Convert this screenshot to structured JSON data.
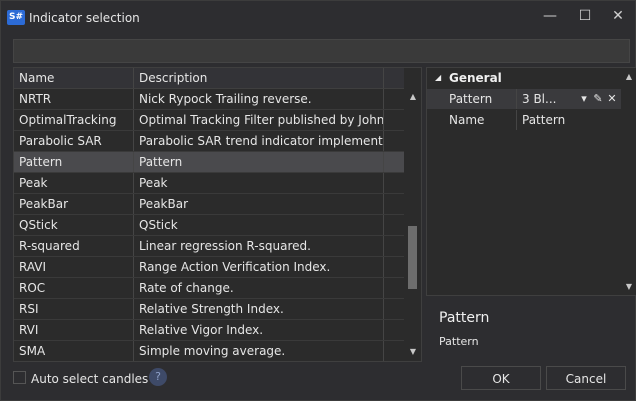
{
  "window": {
    "app_icon": "S#",
    "title": "Indicator selection",
    "controls": {
      "minimize": "—",
      "maximize": "☐",
      "close": "✕"
    }
  },
  "search": {
    "value": "",
    "placeholder": ""
  },
  "grid": {
    "columns": [
      "Name",
      "Description"
    ],
    "rows": [
      [
        "NRTR",
        "Nick Rypock Trailing reverse."
      ],
      [
        "OptimalTracking",
        "Optimal Tracking Filter published by John E..."
      ],
      [
        "Parabolic SAR",
        "Parabolic SAR trend indicator implementati..."
      ],
      [
        "Pattern",
        "Pattern"
      ],
      [
        "Peak",
        "Peak"
      ],
      [
        "PeakBar",
        "PeakBar"
      ],
      [
        "QStick",
        "QStick"
      ],
      [
        "R-squared",
        "Linear regression R-squared."
      ],
      [
        "RAVI",
        "Range Action Verification Index."
      ],
      [
        "ROC",
        "Rate of change."
      ],
      [
        "RSI",
        "Relative Strength Index."
      ],
      [
        "RVI",
        "Relative Vigor Index."
      ],
      [
        "SMA",
        "Simple moving average."
      ]
    ],
    "selected_index": 3
  },
  "properties": {
    "category": "General",
    "rows": [
      {
        "name": "Pattern",
        "value": "3 Bl..."
      },
      {
        "name": "Name",
        "value": "Pattern"
      }
    ]
  },
  "description": {
    "title": "Pattern",
    "text": "Pattern"
  },
  "footer": {
    "auto_select_label": "Auto select candles",
    "auto_select_checked": false,
    "help_glyph": "?",
    "ok_label": "OK",
    "cancel_label": "Cancel"
  },
  "icons": [
    "app-logo-icon",
    "minimize-icon",
    "maximize-icon",
    "close-icon",
    "scroll-up-icon",
    "scroll-down-icon",
    "expand-triangle-icon",
    "dropdown-arrow-icon",
    "edit-pencil-icon",
    "clear-x-icon",
    "help-icon"
  ],
  "colors": {
    "background": "#2d2d30",
    "selected_row": "#4a4a4d",
    "app_icon": "#2c6bd6"
  }
}
